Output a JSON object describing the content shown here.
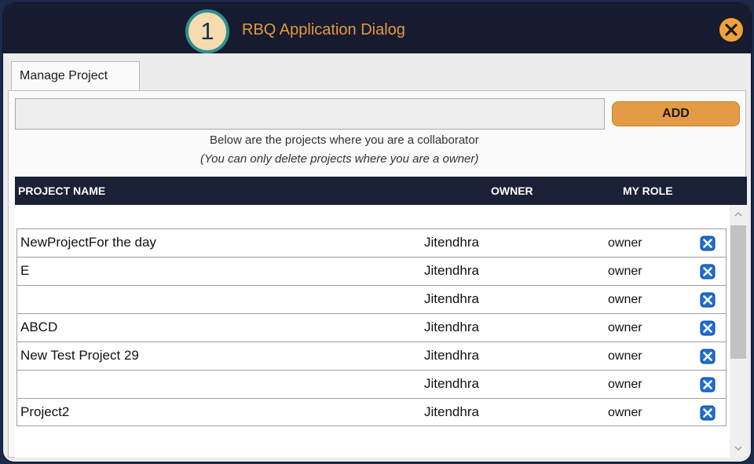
{
  "dialog": {
    "step_number": "1",
    "title": "RBQ Application Dialog"
  },
  "tab": {
    "label": "Manage Project"
  },
  "form": {
    "project_input_value": "",
    "add_label": "ADD"
  },
  "notes": {
    "line1": "Below are the projects where you are a collaborator",
    "line2": "(You can only delete projects where you are a owner)"
  },
  "table": {
    "columns": [
      "PROJECT NAME",
      "OWNER",
      "MY ROLE"
    ],
    "rows": [
      {
        "name": "NewProjectFor the day",
        "owner": "Jitendhra",
        "role": "owner"
      },
      {
        "name": "E",
        "owner": "Jitendhra",
        "role": "owner"
      },
      {
        "name": "",
        "owner": "Jitendhra",
        "role": "owner"
      },
      {
        "name": "ABCD",
        "owner": "Jitendhra",
        "role": "owner"
      },
      {
        "name": "New Test Project 29",
        "owner": "Jitendhra",
        "role": "owner"
      },
      {
        "name": "",
        "owner": "Jitendhra",
        "role": "owner"
      },
      {
        "name": "Project2",
        "owner": "Jitendhra",
        "role": "owner"
      }
    ]
  },
  "colors": {
    "title_bar": "#161b30",
    "accent_orange": "#e49b45",
    "delete_blue": "#1e6fd6",
    "header_bg": "#1a2035"
  },
  "icons": {
    "close": "close-icon",
    "delete": "delete-icon",
    "scroll_up": "chevron-up-icon",
    "scroll_down": "chevron-down-icon"
  }
}
